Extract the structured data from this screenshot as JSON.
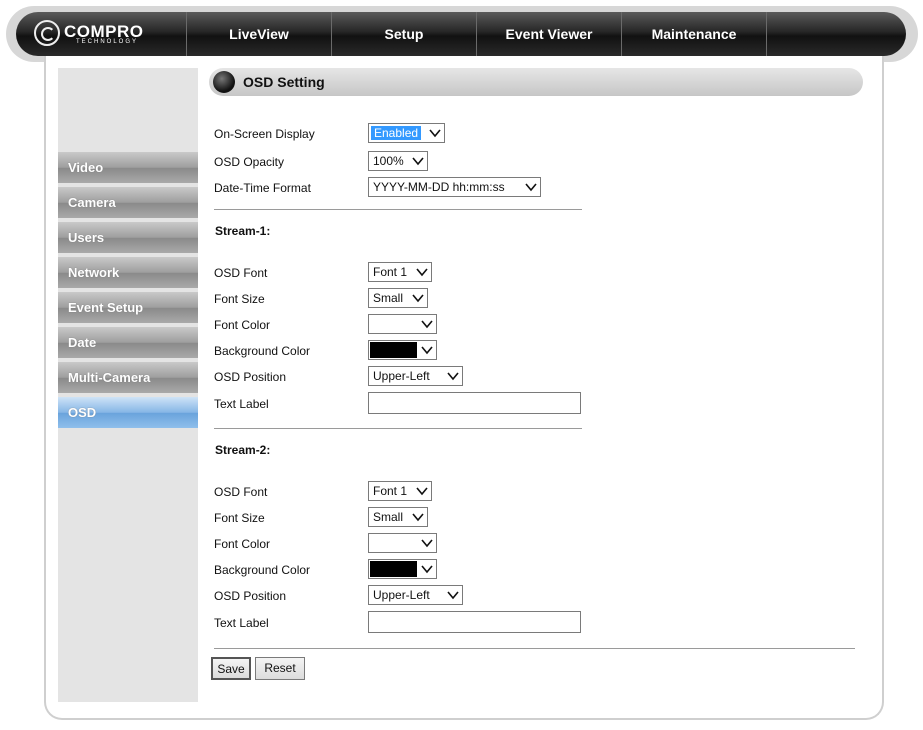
{
  "nav": {
    "logo_main": "COMPRO",
    "logo_sub": "TECHNOLOGY",
    "items": [
      "LiveView",
      "Setup",
      "Event Viewer",
      "Maintenance"
    ]
  },
  "sidebar": {
    "items": [
      "Video",
      "Camera",
      "Users",
      "Network",
      "Event Setup",
      "Date",
      "Multi-Camera",
      "OSD"
    ],
    "active": "OSD"
  },
  "header": {
    "title": "OSD Setting"
  },
  "general": {
    "osd_label": "On-Screen Display",
    "osd_value": "Enabled",
    "opacity_label": "OSD Opacity",
    "opacity_value": "100%",
    "datetime_label": "Date-Time Format",
    "datetime_value": "YYYY-MM-DD hh:mm:ss"
  },
  "streams": [
    {
      "title": "Stream-1:",
      "font_label": "OSD Font",
      "font_value": "Font 1",
      "size_label": "Font Size",
      "size_value": "Small",
      "color_label": "Font Color",
      "color_value": "#ffffff",
      "bg_label": "Background Color",
      "bg_value": "#000000",
      "position_label": "OSD Position",
      "position_value": "Upper-Left",
      "text_label": "Text Label",
      "text_value": ""
    },
    {
      "title": "Stream-2:",
      "font_label": "OSD Font",
      "font_value": "Font 1",
      "size_label": "Font Size",
      "size_value": "Small",
      "color_label": "Font Color",
      "color_value": "#ffffff",
      "bg_label": "Background Color",
      "bg_value": "#000000",
      "position_label": "OSD Position",
      "position_value": "Upper-Left",
      "text_label": "Text Label",
      "text_value": ""
    }
  ],
  "buttons": {
    "save": "Save",
    "reset": "Reset"
  },
  "colors": {
    "active_tab": "#86b6e6",
    "highlight": "#3399ff"
  }
}
